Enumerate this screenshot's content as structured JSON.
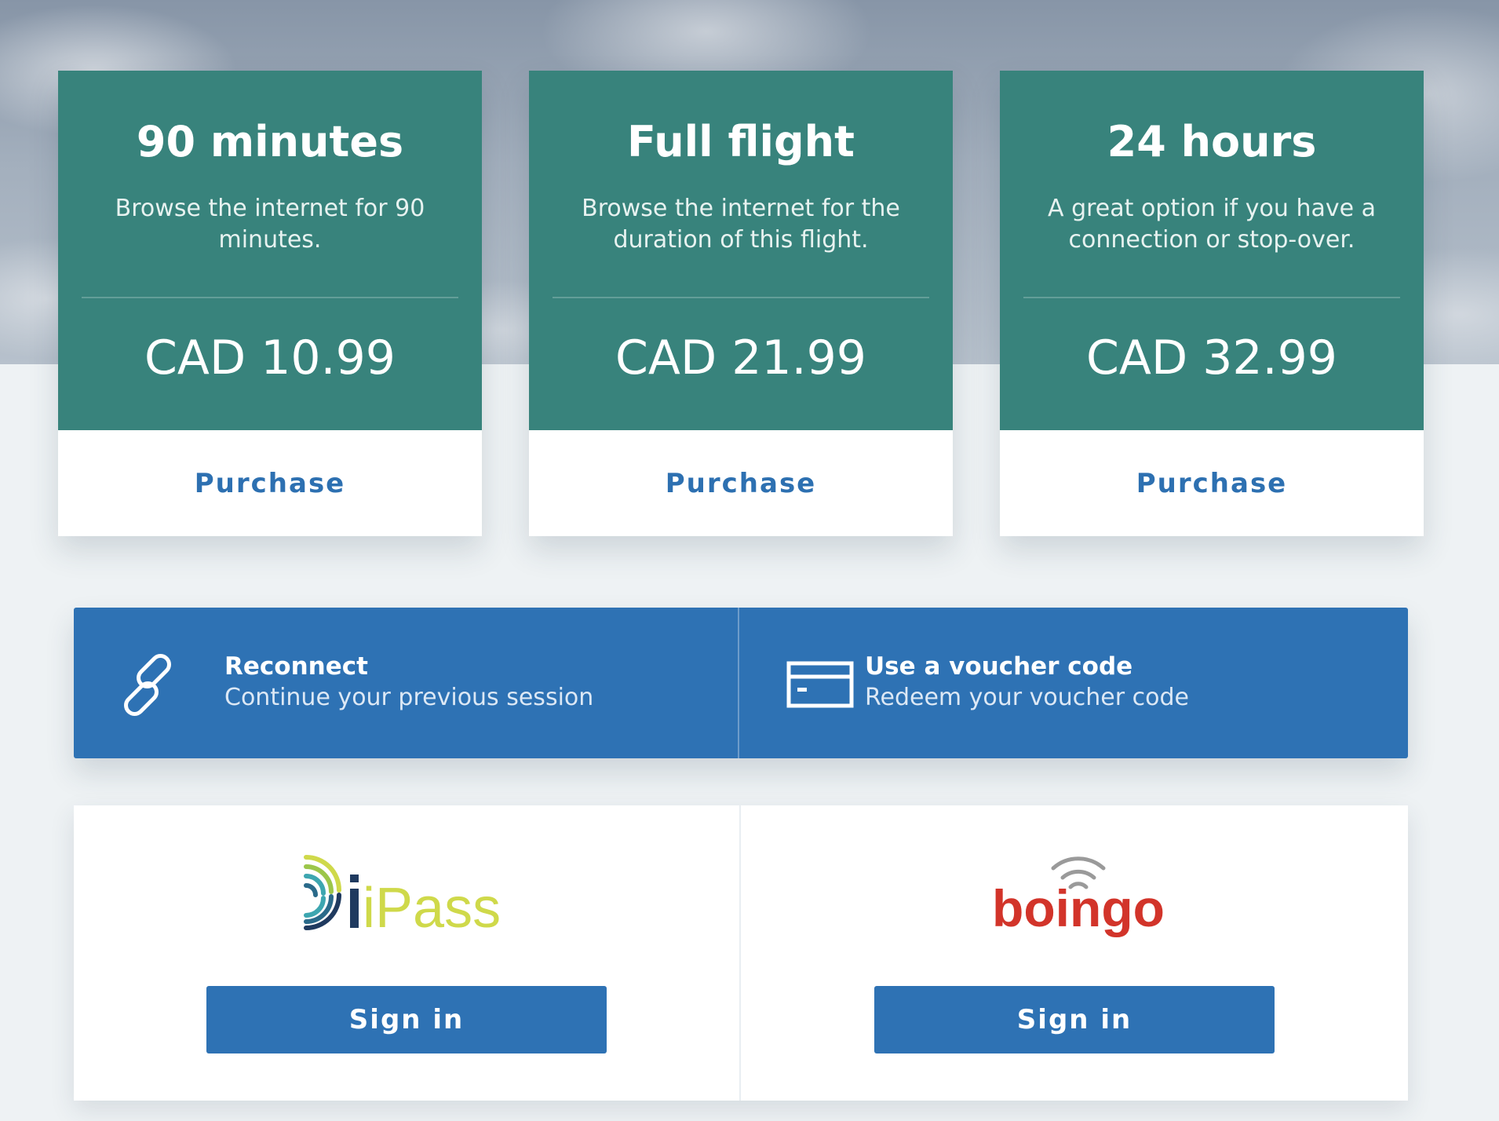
{
  "plans": [
    {
      "title": "90 minutes",
      "description": "Browse the internet for 90 minutes.",
      "price": "CAD 10.99",
      "action_label": "Purchase"
    },
    {
      "title": "Full flight",
      "description": "Browse the internet for the duration of this flight.",
      "price": "CAD 21.99",
      "action_label": "Purchase"
    },
    {
      "title": "24 hours",
      "description": "A great option if you have a connection or stop-over.",
      "price": "CAD 32.99",
      "action_label": "Purchase"
    }
  ],
  "actions": [
    {
      "title": "Reconnect",
      "subtitle": "Continue your previous session",
      "icon": "link-icon"
    },
    {
      "title": "Use a voucher code",
      "subtitle": "Redeem your voucher code",
      "icon": "card-icon"
    }
  ],
  "partners": [
    {
      "logo_text": "iPass",
      "button_label": "Sign in"
    },
    {
      "logo_text": "boingo",
      "button_label": "Sign in"
    }
  ],
  "colors": {
    "card_teal": "#38837c",
    "brand_blue": "#2e72b4",
    "link_blue": "#2d70b1",
    "page_background": "#eef2f4",
    "ipass_yellow": "#cfd94a",
    "boingo_red": "#d2342a"
  }
}
